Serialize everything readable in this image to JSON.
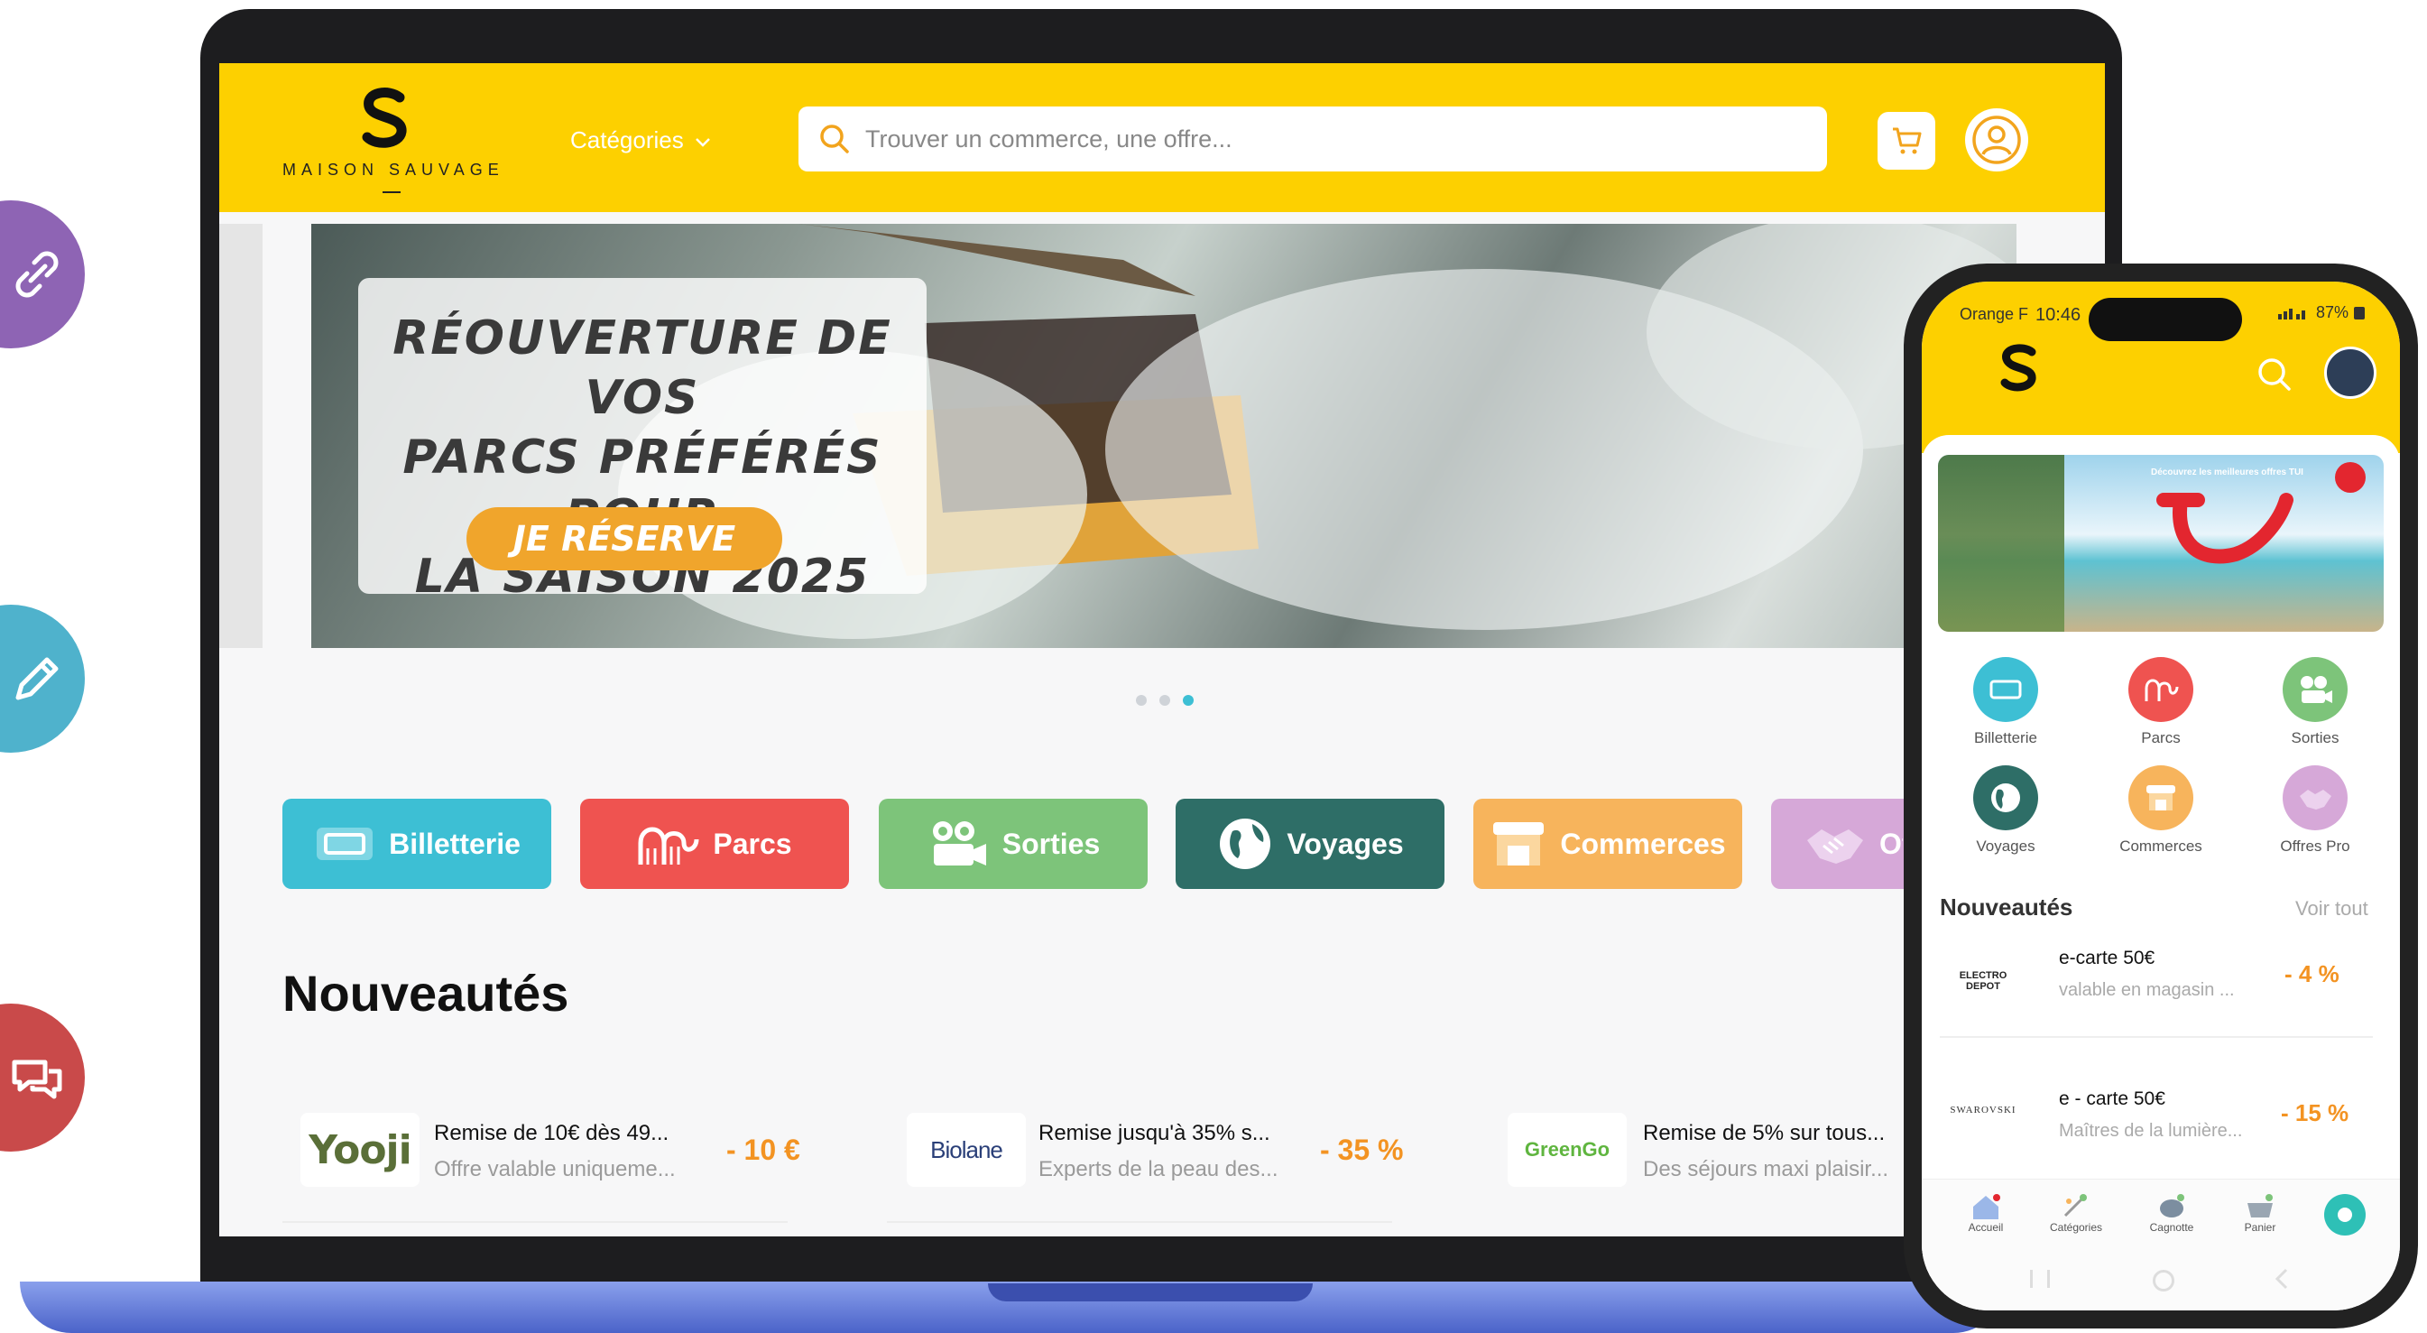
{
  "side_icons": [
    {
      "name": "link-icon",
      "color": "#8e64b4"
    },
    {
      "name": "pencil-icon",
      "color": "#4fb2cc"
    },
    {
      "name": "chat-icon",
      "color": "#c94a4a"
    }
  ],
  "header": {
    "brand": "MAISON SAUVAGE",
    "categories_label": "Catégories",
    "search_placeholder": "Trouver un commerce, une offre..."
  },
  "banner": {
    "title_line1": "RÉOUVERTURE DE VOS",
    "title_line2": "PARCS PRÉFÉRÉS POUR",
    "title_line3": "LA SAISON 2025",
    "button_label": "JE RÉSERVE",
    "dots_count": 3,
    "active_dot": 3
  },
  "categories": [
    {
      "label": "Billetterie",
      "color": "#3dbfd4",
      "icon": "ticket-icon"
    },
    {
      "label": "Parcs",
      "color": "#ef5350",
      "icon": "roller-coaster-icon"
    },
    {
      "label": "Sorties",
      "color": "#7dc47a",
      "icon": "camera-icon"
    },
    {
      "label": "Voyages",
      "color": "#2e6e67",
      "icon": "globe-icon"
    },
    {
      "label": "Commerces",
      "color": "#f7b45c",
      "icon": "store-icon"
    },
    {
      "label": "Offres Pro",
      "color": "#d6a8d8",
      "icon": "handshake-icon"
    }
  ],
  "news": {
    "title": "Nouveautés",
    "offers": [
      {
        "brand": "Yooji",
        "title": "Remise de 10€ dès 49...",
        "subtitle": "Offre valable uniqueme...",
        "discount": "- 10 €"
      },
      {
        "brand": "Biolane",
        "title": "Remise jusqu'à 35% s...",
        "subtitle": "Experts de la peau des...",
        "discount": "- 35 %"
      },
      {
        "brand": "GreenGo",
        "title": "Remise de 5% sur tous...",
        "subtitle": "Des séjours maxi plaisir...",
        "discount": ""
      }
    ]
  },
  "phone": {
    "carrier": "Orange F",
    "time": "10:46",
    "battery": "87%",
    "promo_text": "Découvrez les meilleures offres TUI",
    "categories": [
      {
        "label": "Billetterie",
        "color": "#3dbfd4"
      },
      {
        "label": "Parcs",
        "color": "#ef5350"
      },
      {
        "label": "Sorties",
        "color": "#7dc47a"
      },
      {
        "label": "Voyages",
        "color": "#2e6e67"
      },
      {
        "label": "Commerces",
        "color": "#f7b45c"
      },
      {
        "label": "Offres Pro",
        "color": "#d6a8d8"
      }
    ],
    "news_title": "Nouveautés",
    "see_all": "Voir tout",
    "offers": [
      {
        "brand": "ELECTRO DEPOT",
        "title": "e-carte 50€",
        "subtitle": "valable en magasin ...",
        "discount": "- 4 %"
      },
      {
        "brand": "SWAROVSKI",
        "title": "e - carte 50€",
        "subtitle": "Maîtres de la lumière...",
        "discount": "- 15 %"
      }
    ],
    "nav": [
      {
        "label": "Accueil"
      },
      {
        "label": "Catégories"
      },
      {
        "label": "Cagnotte"
      },
      {
        "label": "Panier"
      }
    ]
  }
}
